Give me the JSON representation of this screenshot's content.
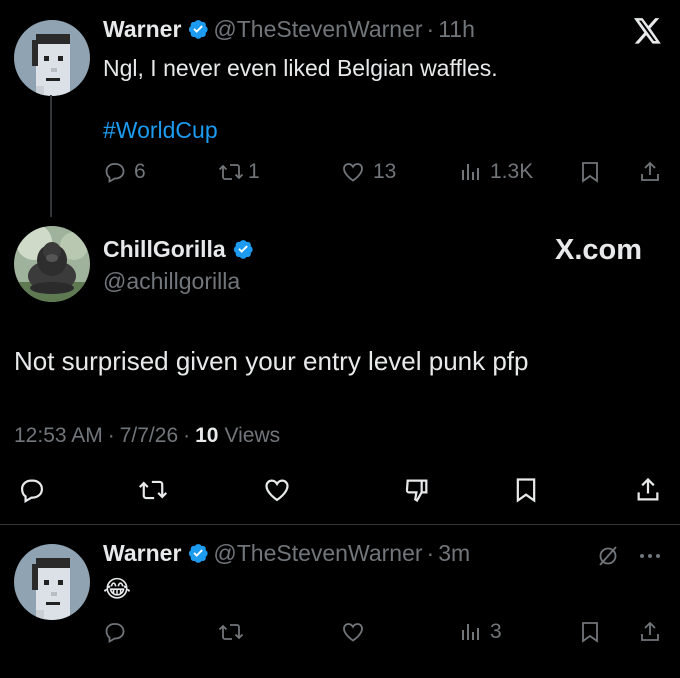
{
  "parent_tweet": {
    "name": "Warner",
    "handle": "@TheStevenWarner",
    "separator": "·",
    "time": "11h",
    "text": "Ngl, I never even liked Belgian waffles.",
    "hashtag": "#WorldCup",
    "replies": "6",
    "retweets": "1",
    "likes": "13",
    "views": "1.3K"
  },
  "main_tweet": {
    "name": "ChillGorilla",
    "handle": "@achillgorilla",
    "site_label": "X.com",
    "text": "Not surprised given your entry level punk pfp",
    "time": "12:53 AM",
    "date": "7/7/26",
    "dot": "·",
    "views_count": "10",
    "views_label": "Views"
  },
  "reply_tweet": {
    "name": "Warner",
    "handle": "@TheStevenWarner",
    "separator": "·",
    "time": "3m",
    "text": "😂",
    "views": "3"
  },
  "icons": {
    "close": "x-logo-icon",
    "verified_color": "#1d9bf0",
    "accent": "#1d9bf0"
  }
}
